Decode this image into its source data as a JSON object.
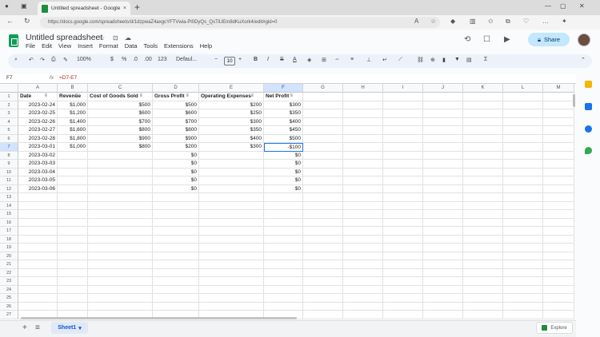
{
  "browser": {
    "tab_title": "Untitled spreadsheet - Google S",
    "tab_close": "×",
    "new_tab": "+",
    "url": "https://docs.google.com/spreadsheets/d/1dzpwaZ4axgcYFTVwia-Pl0DyQs_QsTiUEm8dKuXork4/edit#gid=0",
    "minimize": "—",
    "maximize": "▢",
    "close": "✕"
  },
  "app": {
    "doc_title": "Untitled spreadsheet",
    "menus": [
      "File",
      "Edit",
      "View",
      "Insert",
      "Format",
      "Data",
      "Tools",
      "Extensions",
      "Help"
    ],
    "share_label": "Share"
  },
  "toolbar": {
    "zoom": "100%",
    "currency": "$",
    "percent": "%",
    "decimal_decrease": ".0",
    "decimal_increase": ".00",
    "number_format": "123",
    "font": "Defaul...",
    "font_size": "10",
    "minus": "−",
    "plus": "+",
    "bold": "B",
    "italic": "I",
    "strike": "S",
    "text_color": "A"
  },
  "formula_bar": {
    "cell_ref": "F7",
    "fx": "fx",
    "formula": "=D7-E7"
  },
  "grid": {
    "columns": [
      "A",
      "B",
      "C",
      "D",
      "E",
      "F",
      "G",
      "H",
      "I",
      "J",
      "K",
      "L",
      "M"
    ],
    "rows": [
      "1",
      "2",
      "3",
      "4",
      "5",
      "6",
      "7",
      "8",
      "9",
      "10",
      "11",
      "12",
      "13",
      "14",
      "15",
      "16",
      "17",
      "18",
      "19",
      "20",
      "21",
      "22",
      "23",
      "24",
      "25",
      "26",
      "27"
    ],
    "headers": [
      "Date",
      "Revenue",
      "Cost of Goods Sold",
      "Gross Profit",
      "Operating Expenses",
      "Net Profit"
    ],
    "data": [
      [
        "2023-02-24",
        "$1,000",
        "$500",
        "$500",
        "$200",
        "$300"
      ],
      [
        "2023-02-25",
        "$1,200",
        "$600",
        "$600",
        "$250",
        "$350"
      ],
      [
        "2023-02-26",
        "$1,400",
        "$700",
        "$700",
        "$300",
        "$400"
      ],
      [
        "2023-02-27",
        "$1,600",
        "$800",
        "$800",
        "$350",
        "$450"
      ],
      [
        "2023-02-28",
        "$1,800",
        "$900",
        "$900",
        "$400",
        "$500"
      ],
      [
        "2023-03-01",
        "$1,000",
        "$800",
        "$200",
        "$300",
        "-$100"
      ],
      [
        "2023-03-02",
        "",
        "",
        "$0",
        "",
        "$0"
      ],
      [
        "2023-03-03",
        "",
        "",
        "$0",
        "",
        "$0"
      ],
      [
        "2023-03-04",
        "",
        "",
        "$0",
        "",
        "$0"
      ],
      [
        "2023-03-05",
        "",
        "",
        "$0",
        "",
        "$0"
      ],
      [
        "2023-03-06",
        "",
        "",
        "$0",
        "",
        "$0"
      ]
    ],
    "selected_column": "F",
    "selected_row": "7"
  },
  "bottom": {
    "add_sheet": "+",
    "all_sheets": "≡",
    "sheet_name": "Sheet1",
    "explore_label": "Explore"
  },
  "colors": {
    "selection": "#1a73e8",
    "share_bg": "#c2e7ff",
    "sheets_green": "#0f9d58",
    "negative": "#c5221f"
  }
}
